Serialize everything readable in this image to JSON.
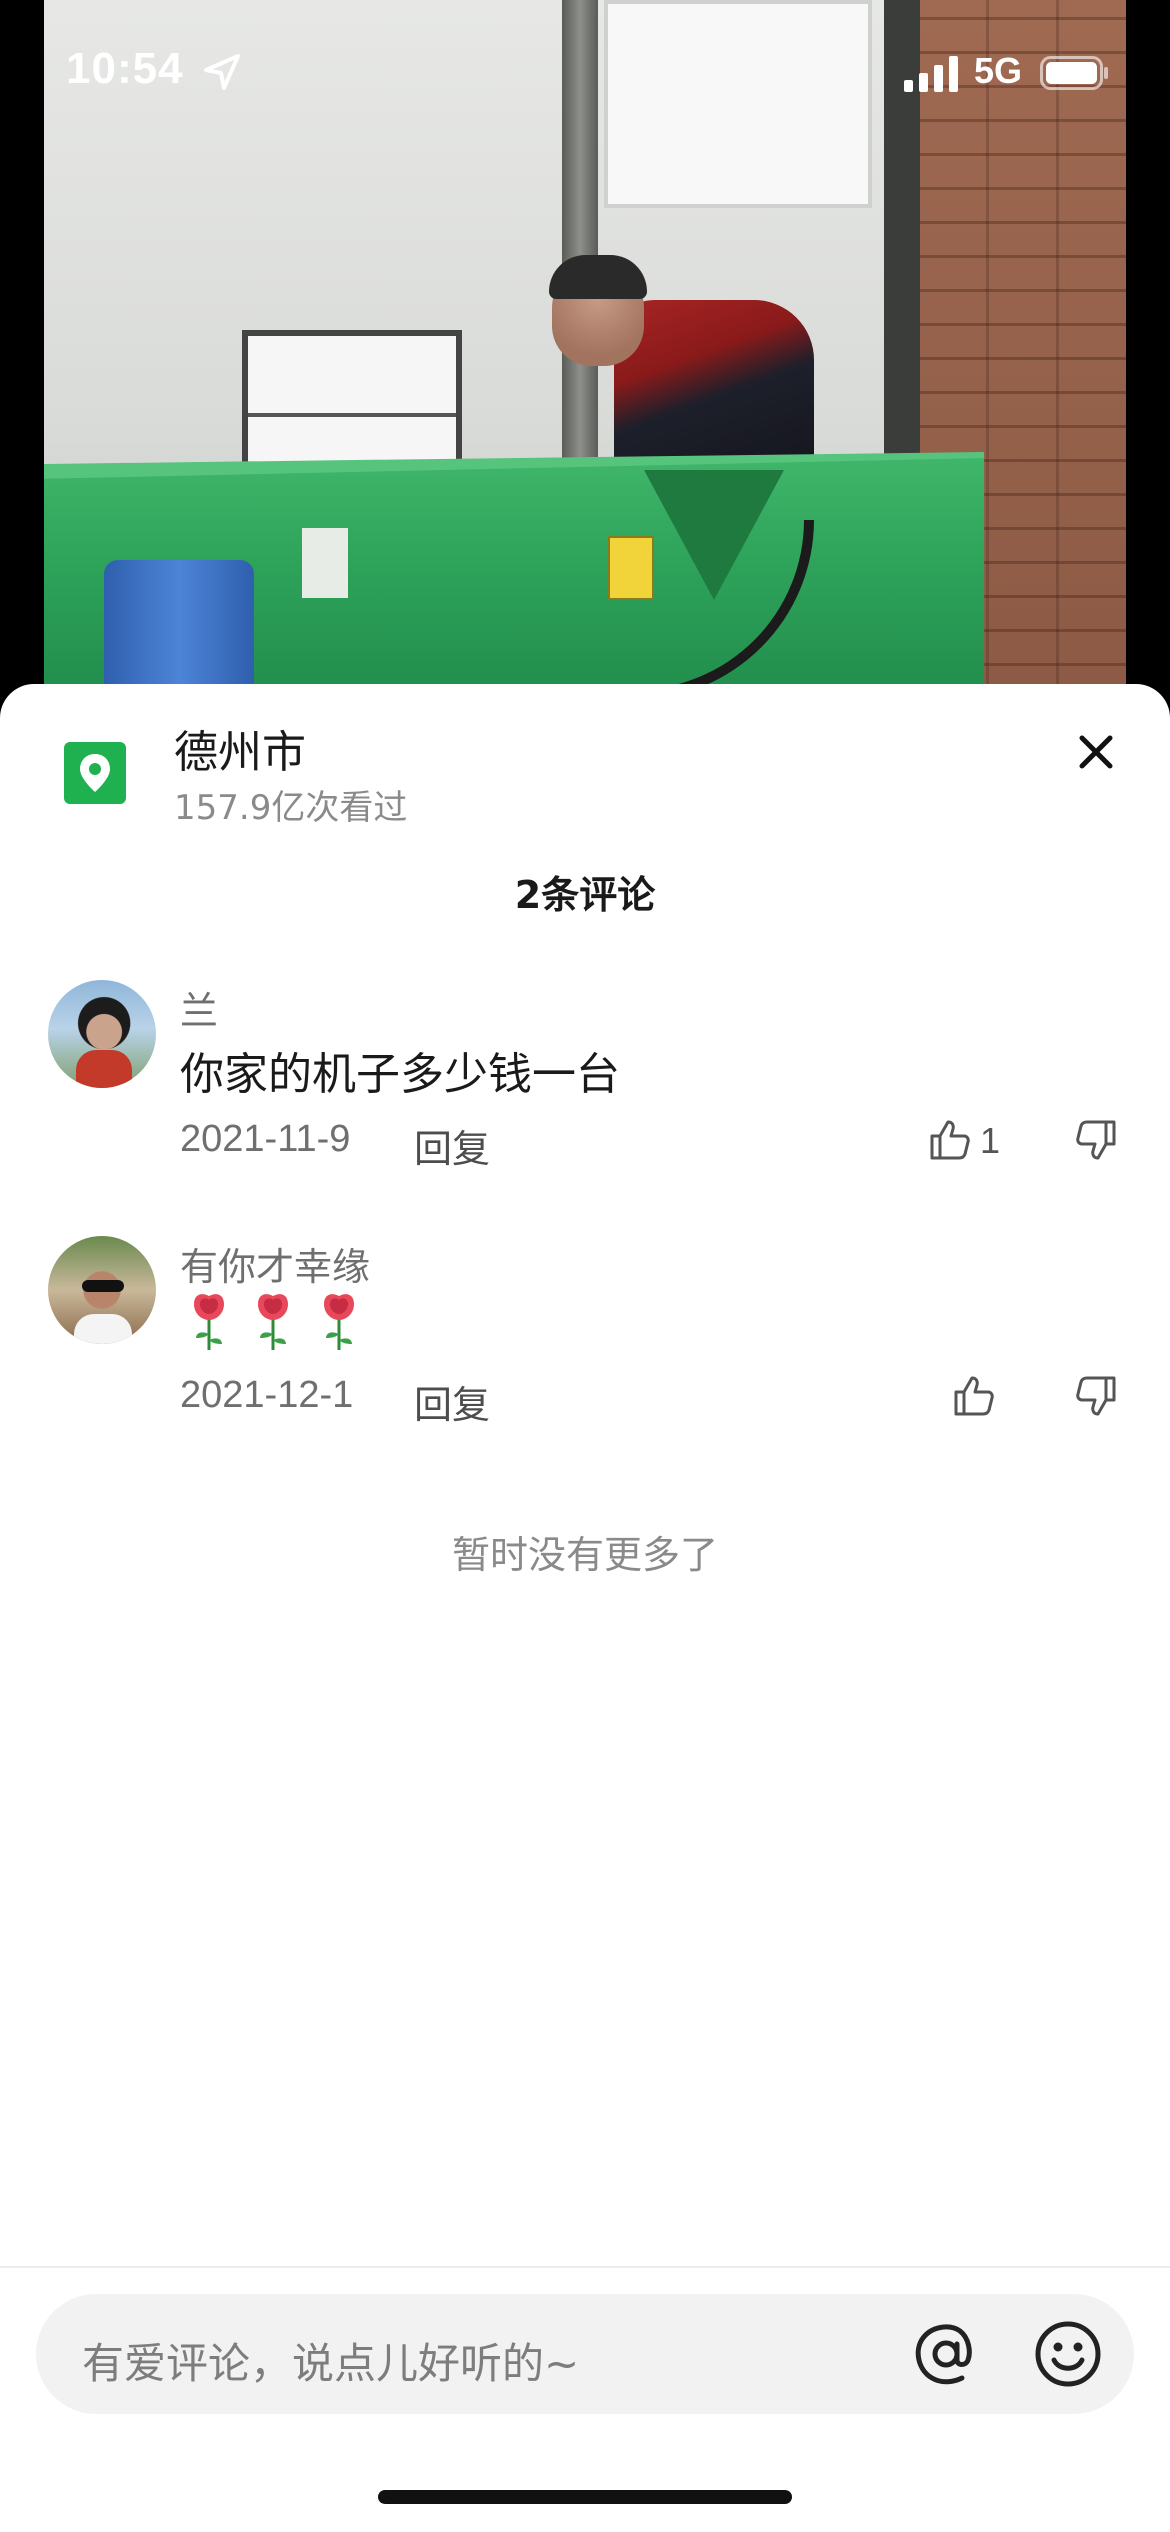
{
  "status_bar": {
    "time": "10:54",
    "network": "5G"
  },
  "location": {
    "title": "德州市",
    "views": "157.9亿次看过"
  },
  "comments_header": {
    "title": "2条评论"
  },
  "comments": [
    {
      "author": "兰",
      "text": "你家的机子多少钱一台",
      "date": "2021-11-9",
      "reply_label": "回复",
      "likes": "1"
    },
    {
      "author": "有你才幸缘",
      "text": "",
      "emoji": "rose-emoji",
      "emoji_count": 3,
      "date": "2021-12-1",
      "reply_label": "回复",
      "likes": ""
    }
  ],
  "footer": {
    "no_more": "暂时没有更多了"
  },
  "input": {
    "placeholder": "有爱评论，说点儿好听的~"
  },
  "colors": {
    "accent_green": "#1fb04f",
    "sheet_bg": "#ffffff",
    "input_bg": "#f2f2f2"
  },
  "icons": {
    "location": "location-pin-icon",
    "close": "close-icon",
    "like": "thumbs-up-icon",
    "dislike": "thumbs-down-icon",
    "mention": "at-sign-icon",
    "emoji": "smiley-face-icon"
  }
}
